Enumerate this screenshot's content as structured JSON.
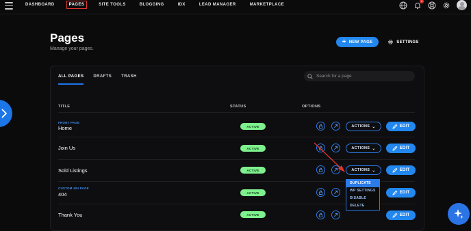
{
  "nav": {
    "items": [
      "DASHBOARD",
      "PAGES",
      "SITE TOOLS",
      "BLOGGING",
      "IDX",
      "LEAD MANAGER",
      "MARKETPLACE"
    ],
    "active": "PAGES",
    "notification_count": "1",
    "icons": [
      "globe-icon",
      "bell-icon",
      "support-icon",
      "gear-icon",
      "avatar"
    ]
  },
  "header": {
    "title": "Pages",
    "subtitle": "Manage your pages.",
    "new_page_label": "NEW PAGE",
    "settings_label": "SETTINGS"
  },
  "tabs": [
    "ALL PAGES",
    "DRAFTS",
    "TRASH"
  ],
  "search": {
    "placeholder": "Search for a page",
    "value": ""
  },
  "table": {
    "columns": [
      "TITLE",
      "STATUS",
      "OPTIONS"
    ],
    "rows": [
      {
        "tag": "FRONT PAGE",
        "title": "Home",
        "status": "ACTIVE"
      },
      {
        "tag": "",
        "title": "Join Us",
        "status": "ACTIVE"
      },
      {
        "tag": "",
        "title": "Sold Listings",
        "status": "ACTIVE"
      },
      {
        "tag": "CUSTOM 404 PAGE",
        "title": "404",
        "status": "ACTIVE"
      },
      {
        "tag": "",
        "title": "Thank You",
        "status": "ACTIVE"
      }
    ],
    "actions_label": "ACTIONS",
    "edit_label": "EDIT"
  },
  "dropdown": {
    "items": [
      "DUPLICATE",
      "WP SETTINGS",
      "DISABLE",
      "DELETE"
    ],
    "highlighted": "DUPLICATE"
  },
  "colors": {
    "accent": "#2287ef",
    "active_nav_border": "#e0342e",
    "status_bg": "#7ef08d",
    "background": "#0b0b0c"
  }
}
